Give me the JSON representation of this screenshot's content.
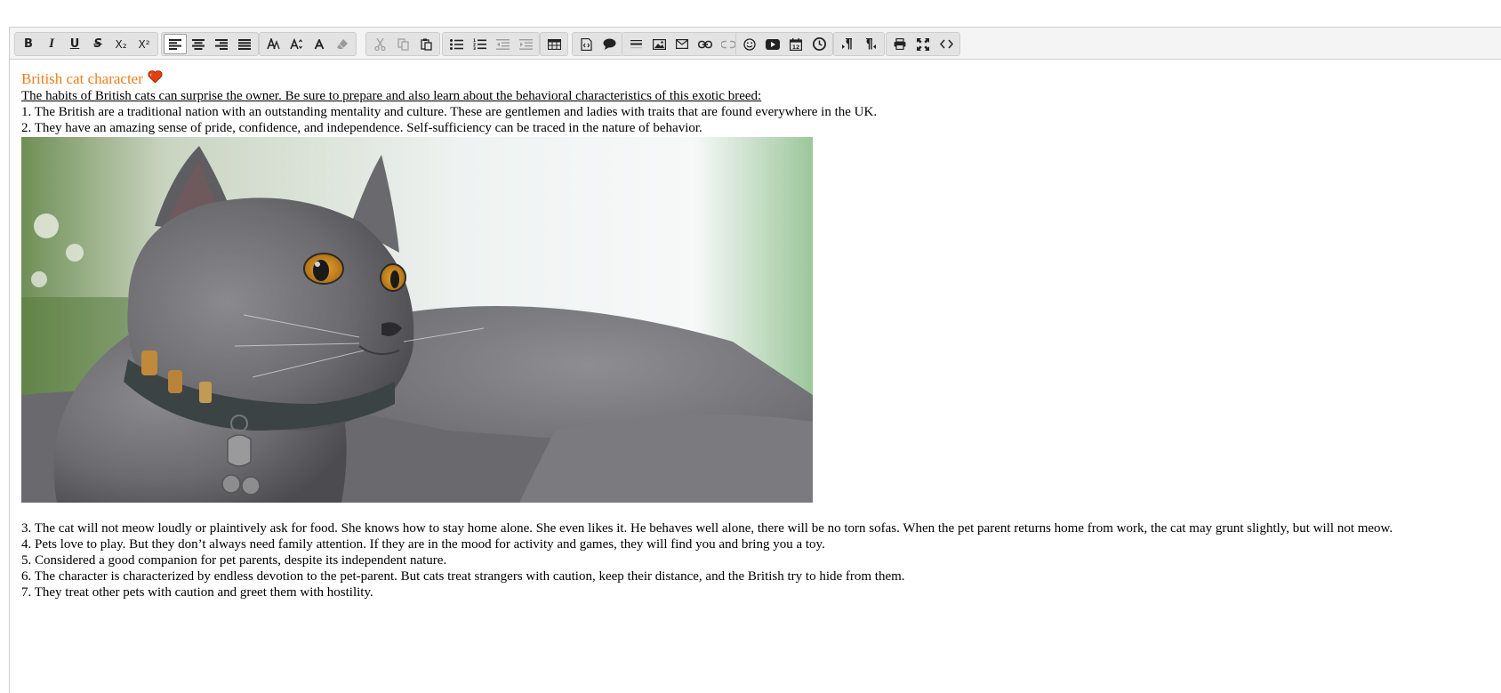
{
  "toolbar": {
    "groups": [
      {
        "id": "text-format",
        "buttons": [
          {
            "name": "bold-button",
            "icon": "bold-icon",
            "label": "B"
          },
          {
            "name": "italic-button",
            "icon": "italic-icon",
            "label": "I"
          },
          {
            "name": "underline-button",
            "icon": "underline-icon",
            "label": "U"
          },
          {
            "name": "strikethrough-button",
            "icon": "strikethrough-icon",
            "label": "S"
          },
          {
            "name": "subscript-button",
            "icon": "subscript-icon",
            "label": "X₂"
          },
          {
            "name": "superscript-button",
            "icon": "superscript-icon",
            "label": "X²"
          }
        ]
      },
      {
        "id": "alignment",
        "buttons": [
          {
            "name": "align-left-button",
            "icon": "align-left-icon",
            "active": true
          },
          {
            "name": "align-center-button",
            "icon": "align-center-icon"
          },
          {
            "name": "align-right-button",
            "icon": "align-right-icon"
          },
          {
            "name": "align-justify-button",
            "icon": "align-justify-icon"
          }
        ]
      },
      {
        "id": "font",
        "buttons": [
          {
            "name": "font-family-button",
            "icon": "font-family-icon"
          },
          {
            "name": "font-size-button",
            "icon": "font-size-icon"
          },
          {
            "name": "font-color-button",
            "icon": "font-color-icon"
          },
          {
            "name": "clear-format-button",
            "icon": "eraser-icon"
          }
        ]
      },
      {
        "id": "clipboard",
        "buttons": [
          {
            "name": "cut-button",
            "icon": "scissors-icon",
            "disabled": true
          },
          {
            "name": "copy-button",
            "icon": "copy-icon",
            "disabled": true
          },
          {
            "name": "paste-button",
            "icon": "paste-icon"
          }
        ]
      },
      {
        "id": "lists",
        "buttons": [
          {
            "name": "bullet-list-button",
            "icon": "bullet-list-icon"
          },
          {
            "name": "numbered-list-button",
            "icon": "numbered-list-icon"
          },
          {
            "name": "outdent-button",
            "icon": "outdent-icon",
            "disabled": true
          },
          {
            "name": "indent-button",
            "icon": "indent-icon",
            "disabled": true
          }
        ]
      },
      {
        "id": "table",
        "buttons": [
          {
            "name": "insert-table-button",
            "icon": "table-icon"
          }
        ]
      },
      {
        "id": "blocks",
        "buttons": [
          {
            "name": "code-block-button",
            "icon": "code-block-icon"
          },
          {
            "name": "quote-button",
            "icon": "speech-bubble-icon"
          }
        ]
      },
      {
        "id": "insert",
        "buttons": [
          {
            "name": "horizontal-rule-button",
            "icon": "horizontal-rule-icon"
          },
          {
            "name": "insert-image-button",
            "icon": "image-icon"
          },
          {
            "name": "insert-email-button",
            "icon": "envelope-icon"
          },
          {
            "name": "insert-link-button",
            "icon": "link-icon"
          },
          {
            "name": "unlink-button",
            "icon": "unlink-icon",
            "disabled": true
          }
        ]
      },
      {
        "id": "media",
        "buttons": [
          {
            "name": "emoji-button",
            "icon": "smiley-icon"
          },
          {
            "name": "insert-video-button",
            "icon": "youtube-icon"
          },
          {
            "name": "insert-date-button",
            "icon": "calendar-icon",
            "label": "12"
          },
          {
            "name": "insert-time-button",
            "icon": "clock-icon"
          }
        ]
      },
      {
        "id": "direction",
        "buttons": [
          {
            "name": "ltr-button",
            "icon": "ltr-icon"
          },
          {
            "name": "rtl-button",
            "icon": "rtl-icon"
          }
        ]
      },
      {
        "id": "view",
        "buttons": [
          {
            "name": "print-button",
            "icon": "printer-icon"
          },
          {
            "name": "maximize-button",
            "icon": "maximize-icon"
          },
          {
            "name": "source-button",
            "icon": "source-code-icon"
          }
        ]
      }
    ]
  },
  "content": {
    "heading": "British cat character",
    "heading_color": "#f07d1c",
    "heart_icon": "heart-icon",
    "intro": "The habits of British cats can surprise the owner. Be sure to prepare and also learn about the behavioral characteristics of this exotic breed:",
    "points_before_image": [
      "1. The British are a traditional nation with an outstanding mentality and culture. These are gentlemen and ladies with traits that are found everywhere in the UK.",
      "2. They have an amazing sense of pride, confidence, and independence. Self-sufficiency can be traced in the nature of behavior."
    ],
    "image_icon": "british-shorthair-cat-photo",
    "points_after_image": [
      "3. The cat will not meow loudly or plaintively ask for food. She knows how to stay home alone. She even likes it. He behaves well alone, there will be no torn sofas. When the pet parent returns home from work, the cat may grunt slightly, but will not meow.",
      "4. Pets love to play. But they don’t always need family attention. If they are in the mood for activity and games, they will find you and bring you a toy.",
      "5. Considered a good companion for pet parents, despite its independent nature.",
      "6. The character is characterized by endless devotion to the pet-parent. But cats treat strangers with caution, keep their distance, and the British try to hide from them.",
      "7. They treat other pets with caution and greet them with hostility."
    ]
  }
}
